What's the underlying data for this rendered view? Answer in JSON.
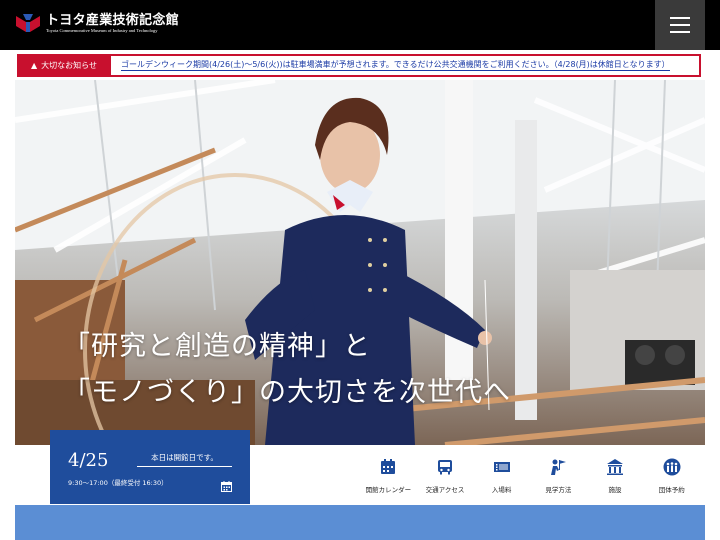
{
  "header": {
    "logo_jp": "トヨタ産業技術記念館",
    "logo_en": "Toyota Commemorative Museum of Industry and Technology",
    "menu_icon": "hamburger-icon"
  },
  "notice": {
    "label": "大切なお知らせ",
    "icon": "warning-icon",
    "text": "ゴールデンウィーク期間(4/26(土)〜5/6(火))は駐車場満車が予想されます。できるだけ公共交通機関をご利用ください。（4/28(月)は休館日となります）"
  },
  "hero": {
    "line1": "「研究と創造の精神」と",
    "line2": "「モノづくり」の大切さを次世代へ"
  },
  "info": {
    "date": "4/25",
    "status": "本日は開館日です。",
    "hours": "9:30〜17:00（最終受付 16:30）",
    "calendar_icon": "calendar-icon"
  },
  "quick_nav": [
    {
      "label": "開館カレンダー",
      "icon": "calendar-icon"
    },
    {
      "label": "交通アクセス",
      "icon": "bus-icon"
    },
    {
      "label": "入場料",
      "icon": "ticket-icon"
    },
    {
      "label": "見学方法",
      "icon": "guide-icon"
    },
    {
      "label": "施設",
      "icon": "building-icon"
    },
    {
      "label": "団体予約",
      "icon": "group-icon"
    }
  ],
  "colors": {
    "header_bg": "#000000",
    "notice_red": "#c8102e",
    "brand_blue": "#1f4d9c",
    "band_blue": "#5b8ed4"
  }
}
